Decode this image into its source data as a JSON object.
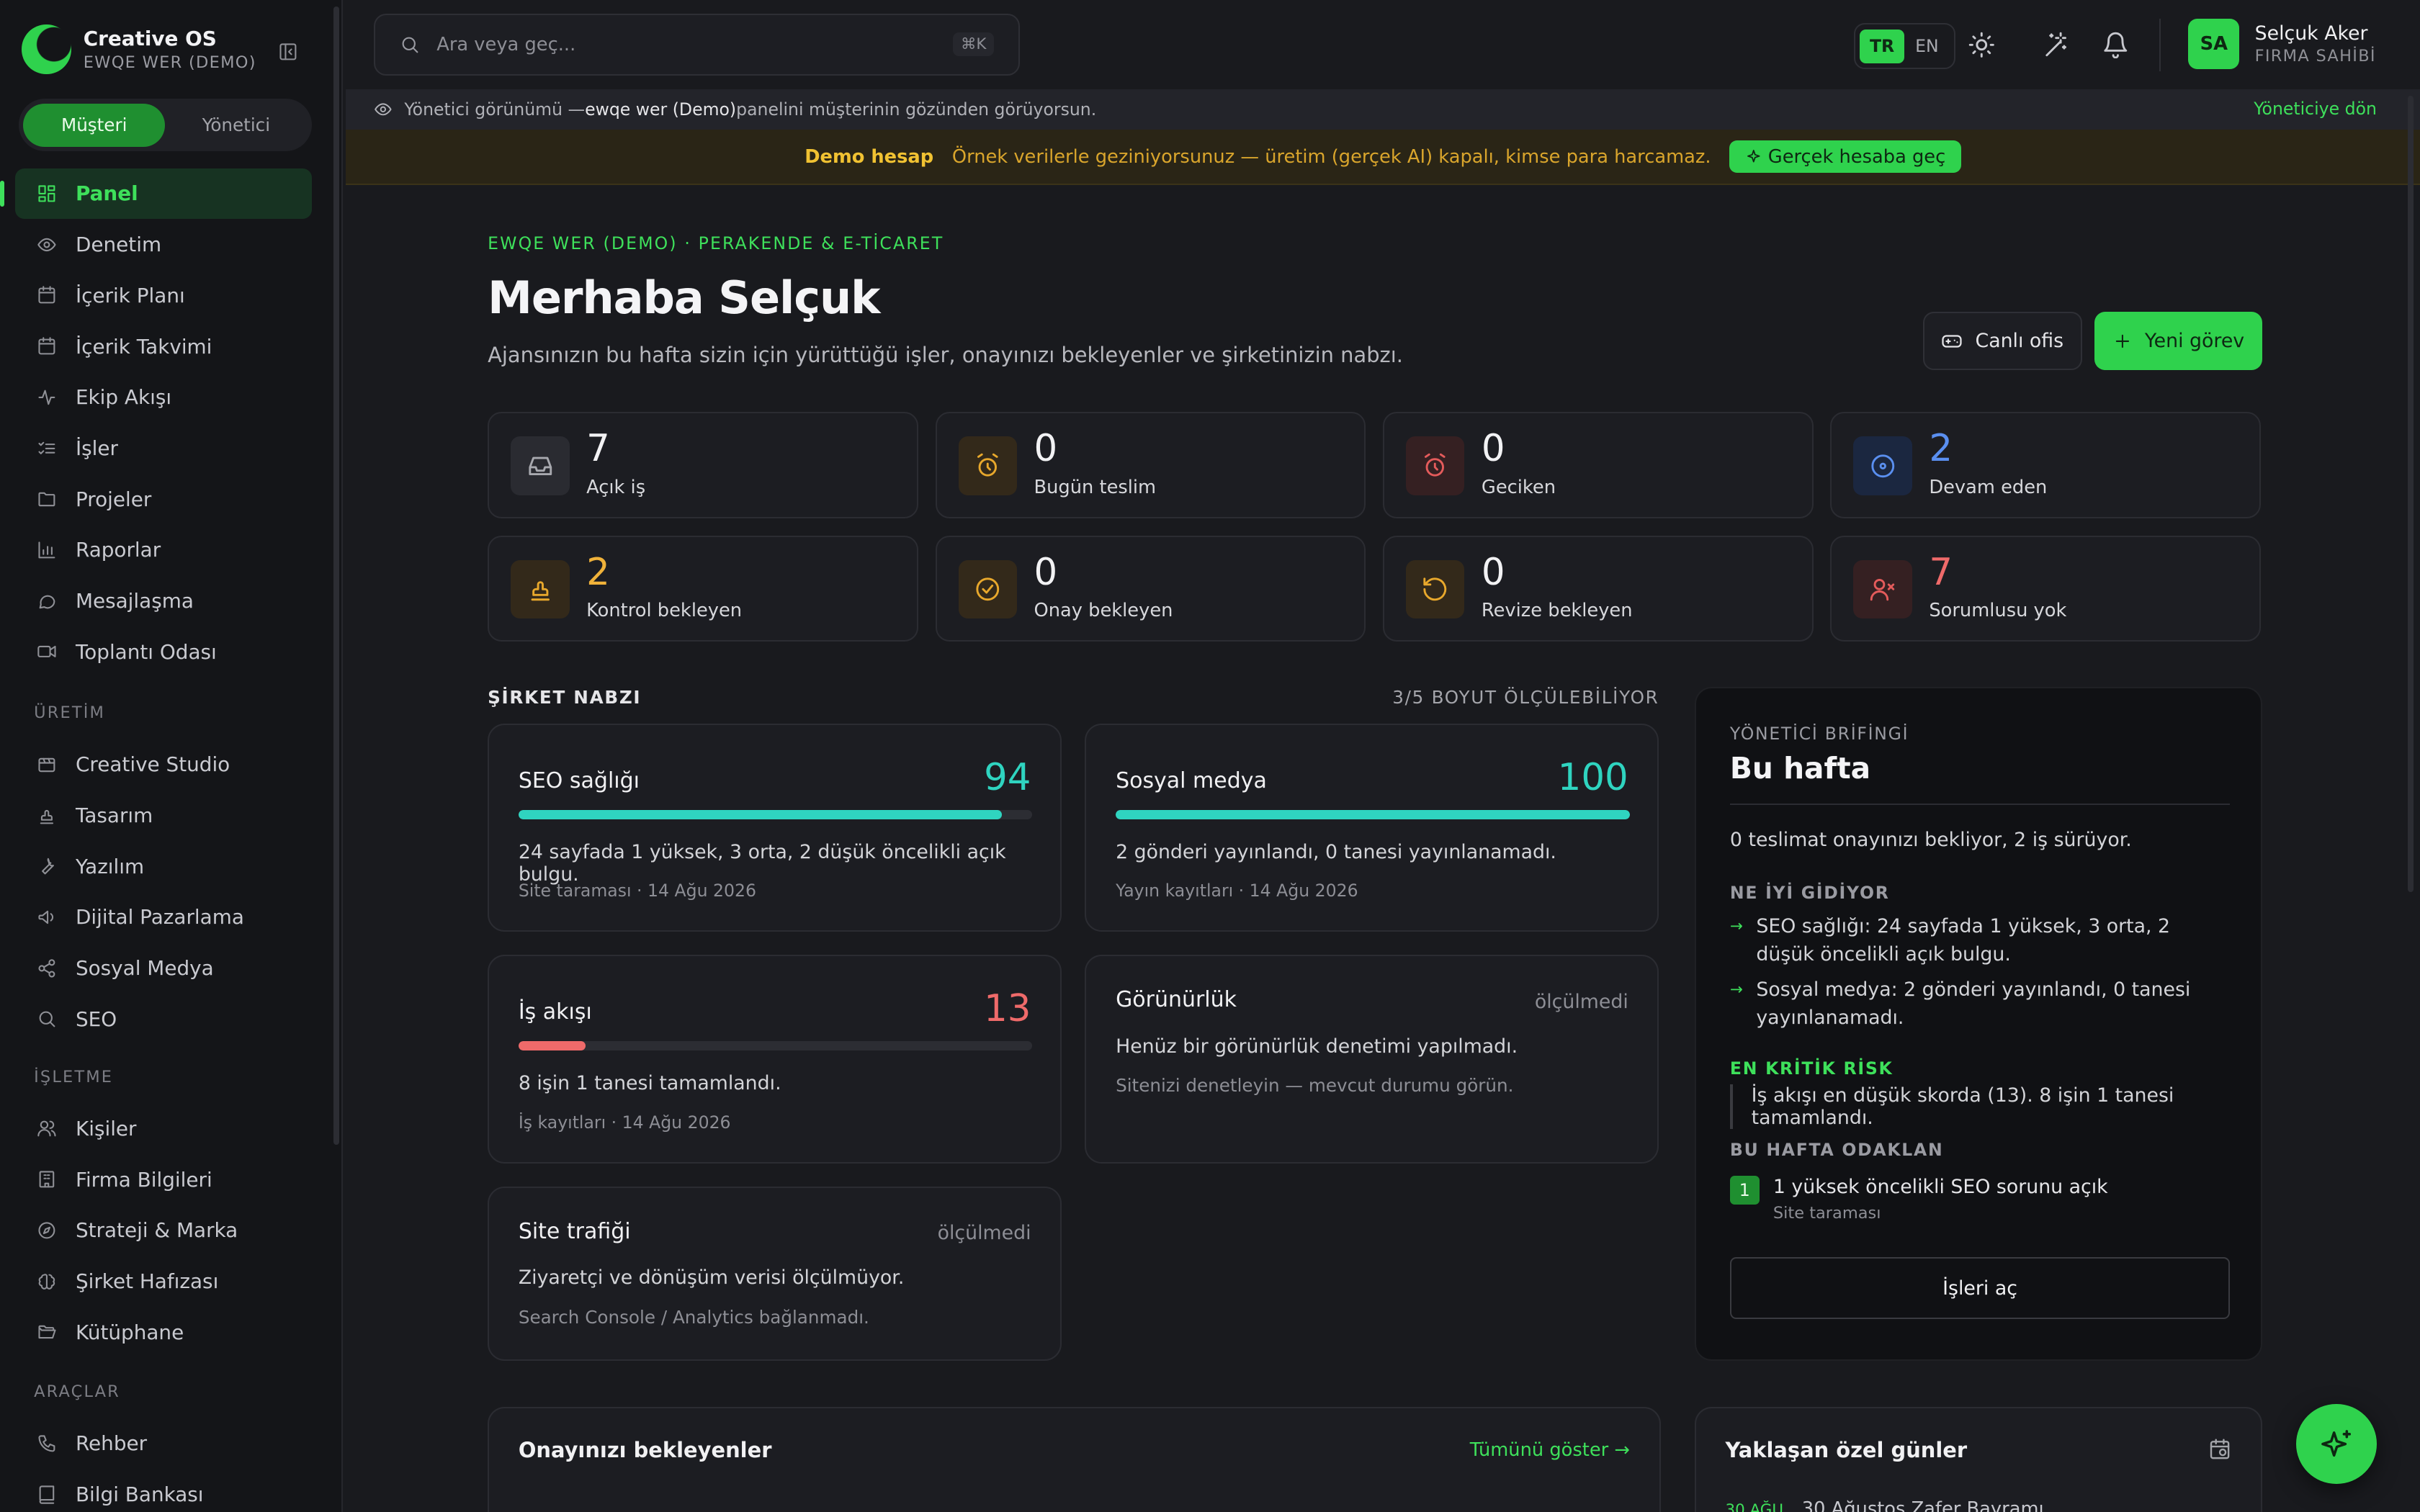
{
  "sidebar": {
    "brand": {
      "name": "Creative OS",
      "sub": "EWQE WER (DEMO)"
    },
    "roles": {
      "customer": "Müşteri",
      "admin": "Yönetici"
    },
    "items": [
      {
        "label": "Panel",
        "icon": "grid-icon"
      },
      {
        "label": "Denetim",
        "icon": "eye-icon"
      },
      {
        "label": "İçerik Planı",
        "icon": "calendar-icon"
      },
      {
        "label": "İçerik Takvimi",
        "icon": "calendar-icon"
      },
      {
        "label": "Ekip Akışı",
        "icon": "activity-icon"
      },
      {
        "label": "İşler",
        "icon": "list-checks-icon"
      },
      {
        "label": "Projeler",
        "icon": "folder-icon"
      },
      {
        "label": "Raporlar",
        "icon": "bar-chart-icon"
      },
      {
        "label": "Mesajlaşma",
        "icon": "message-icon"
      },
      {
        "label": "Toplantı Odası",
        "icon": "video-icon"
      }
    ],
    "section_production": "ÜRETİM",
    "production_items": [
      {
        "label": "Creative Studio",
        "icon": "studio-icon"
      },
      {
        "label": "Tasarım",
        "icon": "stamp-icon"
      },
      {
        "label": "Yazılım",
        "icon": "wrench-icon"
      },
      {
        "label": "Dijital Pazarlama",
        "icon": "megaphone-icon"
      },
      {
        "label": "Sosyal Medya",
        "icon": "share-icon"
      },
      {
        "label": "SEO",
        "icon": "search-icon"
      }
    ],
    "section_business": "İŞLETME",
    "business_items": [
      {
        "label": "Kişiler",
        "icon": "users-icon"
      },
      {
        "label": "Firma Bilgileri",
        "icon": "building-icon"
      },
      {
        "label": "Strateji & Marka",
        "icon": "compass-icon"
      },
      {
        "label": "Şirket Hafızası",
        "icon": "brain-icon"
      },
      {
        "label": "Kütüphane",
        "icon": "folder-open-icon"
      }
    ],
    "section_tools": "ARAÇLAR",
    "tools_items": [
      {
        "label": "Rehber",
        "icon": "phone-icon"
      },
      {
        "label": "Bilgi Bankası",
        "icon": "book-icon"
      }
    ]
  },
  "topbar": {
    "search_placeholder": "Ara veya geç...",
    "shortcut": "⌘K",
    "lang_tr": "TR",
    "lang_en": "EN",
    "user": {
      "initials": "SA",
      "name": "Selçuk Aker",
      "role": "FIRMA SAHİBİ"
    }
  },
  "adminbar": {
    "prefix": "Yönetici görünümü — ",
    "panel": "ewqe wer (Demo)",
    "suffix": " panelini müşterinin gözünden görüyorsun.",
    "back": "Yöneticiye dön"
  },
  "demobar": {
    "title": "Demo hesap",
    "text": "Örnek verilerle geziniyorsunuz — üretim (gerçek AI) kapalı, kimse para harcamaz.",
    "button": "Gerçek hesaba geç"
  },
  "header": {
    "eyebrow": "EWQE WER (DEMO) · PERAKENDE & E-TİCARET",
    "greeting": "Merhaba Selçuk",
    "subtitle": "Ajansınızın bu hafta sizin için yürüttüğü işler, onayınızı bekleyenler ve şirketinizin nabzı.",
    "live_office": "Canlı ofis",
    "new_task": "Yeni görev"
  },
  "stats": [
    {
      "value": "7",
      "label": "Açık iş",
      "icon": "inbox-icon",
      "color": "#f2f2f4",
      "iconcolor": "#a8a9af",
      "iconbg": "#2a2b31"
    },
    {
      "value": "0",
      "label": "Bugün teslim",
      "icon": "alarm-icon",
      "color": "#f2f2f4",
      "iconcolor": "#e8a82c",
      "iconbg": "#33291a"
    },
    {
      "value": "0",
      "label": "Geciken",
      "icon": "alarm-icon",
      "color": "#f2f2f4",
      "iconcolor": "#e45b5b",
      "iconbg": "#352022"
    },
    {
      "value": "2",
      "label": "Devam eden",
      "icon": "target-icon",
      "color": "#5a8ff0",
      "iconcolor": "#5a8ff0",
      "iconbg": "#1b2740"
    },
    {
      "value": "2",
      "label": "Kontrol bekleyen",
      "icon": "stamp-icon",
      "color": "#f0b23a",
      "iconcolor": "#e8a82c",
      "iconbg": "#33291a"
    },
    {
      "value": "0",
      "label": "Onay bekleyen",
      "icon": "check-circle-icon",
      "color": "#f2f2f4",
      "iconcolor": "#e8a82c",
      "iconbg": "#33291a"
    },
    {
      "value": "0",
      "label": "Revize bekleyen",
      "icon": "rotate-icon",
      "color": "#f2f2f4",
      "iconcolor": "#e8a82c",
      "iconbg": "#33291a"
    },
    {
      "value": "7",
      "label": "Sorumlusu yok",
      "icon": "user-x-icon",
      "color": "#ef6a6a",
      "iconcolor": "#e45b5b",
      "iconbg": "#352022"
    }
  ],
  "pulse": {
    "title": "ŞİRKET NABZI",
    "measured": "3/5 BOYUT ÖLÇÜLEBİLİYOR",
    "cards": [
      {
        "title": "SEO sağlığı",
        "score": "94",
        "fill": 0.94,
        "color": "#2fd4c0",
        "desc": "24 sayfada 1 yüksek, 3 orta, 2 düşük öncelikli açık bulgu.",
        "meta": "Site taraması · 14 Ağu 2026"
      },
      {
        "title": "Sosyal medya",
        "score": "100",
        "fill": 1.0,
        "color": "#2fd4c0",
        "desc": "2 gönderi yayınlandı, 0 tanesi yayınlanamadı.",
        "meta": "Yayın kayıtları · 14 Ağu 2026"
      },
      {
        "title": "İş akışı",
        "score": "13",
        "fill": 0.13,
        "color": "#ef6a6a",
        "desc": "8 işin 1 tanesi tamamlandı.",
        "meta": "İş kayıtları · 14 Ağu 2026"
      },
      {
        "title": "Görünürlük",
        "status": "ölçülmedi",
        "desc": "Henüz bir görünürlük denetimi yapılmadı.",
        "meta": "Sitenizi denetleyin — mevcut durumu görün."
      },
      {
        "title": "Site trafiği",
        "status": "ölçülmedi",
        "desc": "Ziyaretçi ve dönüşüm verisi ölçülmüyor.",
        "meta": "Search Console / Analytics bağlanmadı."
      }
    ]
  },
  "brief": {
    "eyebrow": "YÖNETİCİ BRİFİNGİ",
    "title": "Bu hafta",
    "summary": "0 teslimat onayınızı bekliyor, 2 iş sürüyor.",
    "good_title": "NE İYİ GİDİYOR",
    "good": [
      "SEO sağlığı: 24 sayfada 1 yüksek, 3 orta, 2 düşük öncelikli açık bulgu.",
      "Sosyal medya: 2 gönderi yayınlandı, 0 tanesi yayınlanamadı."
    ],
    "risk_title": "EN KRİTİK RİSK",
    "risk": "İş akışı en düşük skorda (13). 8 işin 1 tanesi tamamlandı.",
    "focus_title": "BU HAFTA ODAKLAN",
    "focus": {
      "num": "1",
      "text": "1 yüksek öncelikli SEO sorunu açık",
      "sub": "Site taraması"
    },
    "button": "İşleri aç"
  },
  "bottom": {
    "approvals_title": "Onayınızı bekleyenler",
    "approvals_link": "Tümünü göster →",
    "days_title": "Yaklaşan özel günler",
    "days_first_date": "30 AĞU",
    "days_first": "30 Ağustos Zafer Bayramı"
  }
}
